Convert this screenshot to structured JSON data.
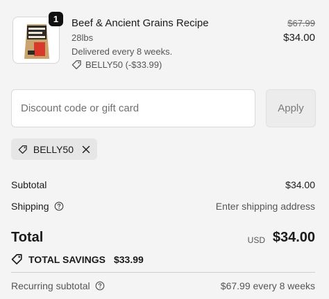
{
  "line_item": {
    "quantity": "1",
    "name": "Beef & Ancient Grains Recipe",
    "weight": "28lbs",
    "delivery": "Delivered every 8 weeks.",
    "discount_applied": "BELLY50 (-$33.99)",
    "original_price": "$67.99",
    "price": "$34.00",
    "image_icon": "dog-food-bag-icon",
    "colors": {
      "bag": "#c9a46c",
      "bag_dark": "#2b2b2b",
      "label": "#d8392b"
    }
  },
  "discount": {
    "placeholder": "Discount code or gift card",
    "apply_label": "Apply",
    "applied_code": "BELLY50"
  },
  "summary": {
    "subtotal_label": "Subtotal",
    "subtotal_value": "$34.00",
    "shipping_label": "Shipping",
    "shipping_value": "Enter shipping address",
    "total_label": "Total",
    "currency": "USD",
    "total_value": "$34.00",
    "savings_label": "TOTAL SAVINGS",
    "savings_value": "$33.99",
    "recurring_label": "Recurring subtotal",
    "recurring_value": "$67.99 every 8 weeks"
  }
}
